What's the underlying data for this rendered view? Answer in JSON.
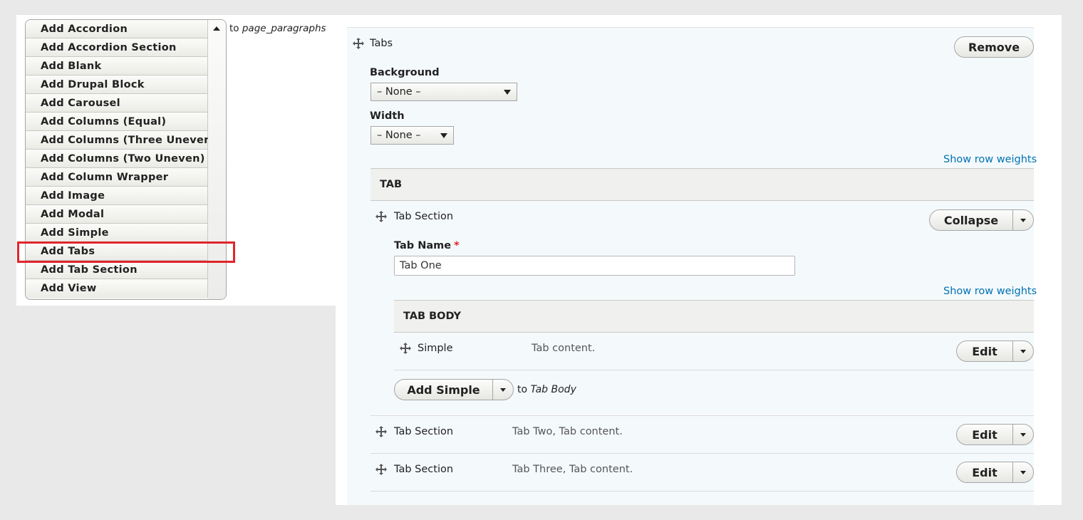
{
  "add_menu": {
    "items": [
      "Add Accordion",
      "Add Accordion Section",
      "Add Blank",
      "Add Drupal Block",
      "Add Carousel",
      "Add Columns (Equal)",
      "Add Columns (Three Uneven)",
      "Add Columns (Two Uneven)",
      "Add Column Wrapper",
      "Add Image",
      "Add Modal",
      "Add Simple",
      "Add Tabs",
      "Add Tab Section",
      "Add View"
    ],
    "to_prefix": "to",
    "to_target": "page_paragraphs",
    "highlighted_item": "Add Tabs"
  },
  "paragraph": {
    "type_label": "Tabs",
    "remove_label": "Remove",
    "background_label": "Background",
    "background_value": "– None –",
    "width_label": "Width",
    "width_value": "– None –",
    "show_row_weights": "Show row weights",
    "tab_header": "TAB",
    "tab_section": {
      "type_label": "Tab Section",
      "collapse_label": "Collapse",
      "tab_name_label": "Tab Name",
      "required_mark": "*",
      "tab_name_value": "Tab One",
      "show_row_weights": "Show row weights",
      "tab_body_header": "TAB BODY",
      "body_row": {
        "type_label": "Simple",
        "summary": "Tab content.",
        "edit_label": "Edit"
      },
      "add_simple_label": "Add Simple",
      "add_to_prefix": "to",
      "add_to_target": "Tab Body"
    },
    "other_sections": [
      {
        "type_label": "Tab Section",
        "summary": "Tab Two, Tab content.",
        "edit_label": "Edit"
      },
      {
        "type_label": "Tab Section",
        "summary": "Tab Three, Tab content.",
        "edit_label": "Edit"
      }
    ]
  },
  "colors": {
    "highlight": "#e0252b",
    "link": "#0071b3",
    "panel_bg": "#f4f9fc",
    "page_bg": "#e9e9e9"
  }
}
